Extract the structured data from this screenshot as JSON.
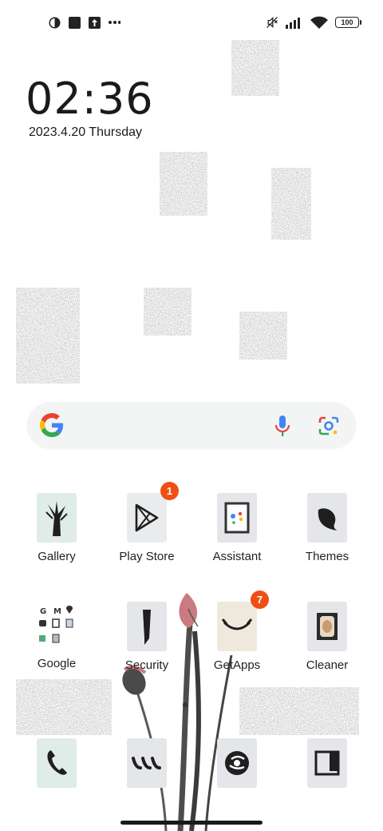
{
  "status_bar": {
    "left_icons": [
      "notification-app-icon",
      "square-notification-icon",
      "upload-icon",
      "more-dots-icon"
    ],
    "right_icons": [
      "mute-icon",
      "signal-icon",
      "wifi-icon",
      "battery-icon"
    ],
    "battery": "100"
  },
  "clock": {
    "time": "02:36",
    "date": "2023.4.20 Thursday"
  },
  "search": {
    "logo": "google-g-icon",
    "mic": "mic-icon",
    "lens": "lens-icon",
    "colors": {
      "blue": "#4285F4",
      "red": "#EA4335",
      "yellow": "#FBBC05",
      "green": "#34A853"
    }
  },
  "apps": [
    {
      "label": "Gallery"
    },
    {
      "label": "Play Store",
      "badge": "1"
    },
    {
      "label": "Assistant"
    },
    {
      "label": "Themes"
    },
    {
      "label": "Google"
    },
    {
      "label": "Security"
    },
    {
      "label": "GetApps",
      "badge": "7"
    },
    {
      "label": "Cleaner"
    }
  ],
  "dock": [
    "phone-icon",
    "messages-icon",
    "browser-icon",
    "camera-icon"
  ],
  "colors": {
    "badge": "#ef4f14",
    "tile_mint": "#dfece8",
    "tile_gray": "#e4e6e9",
    "tile_beige": "#efe9dd"
  }
}
